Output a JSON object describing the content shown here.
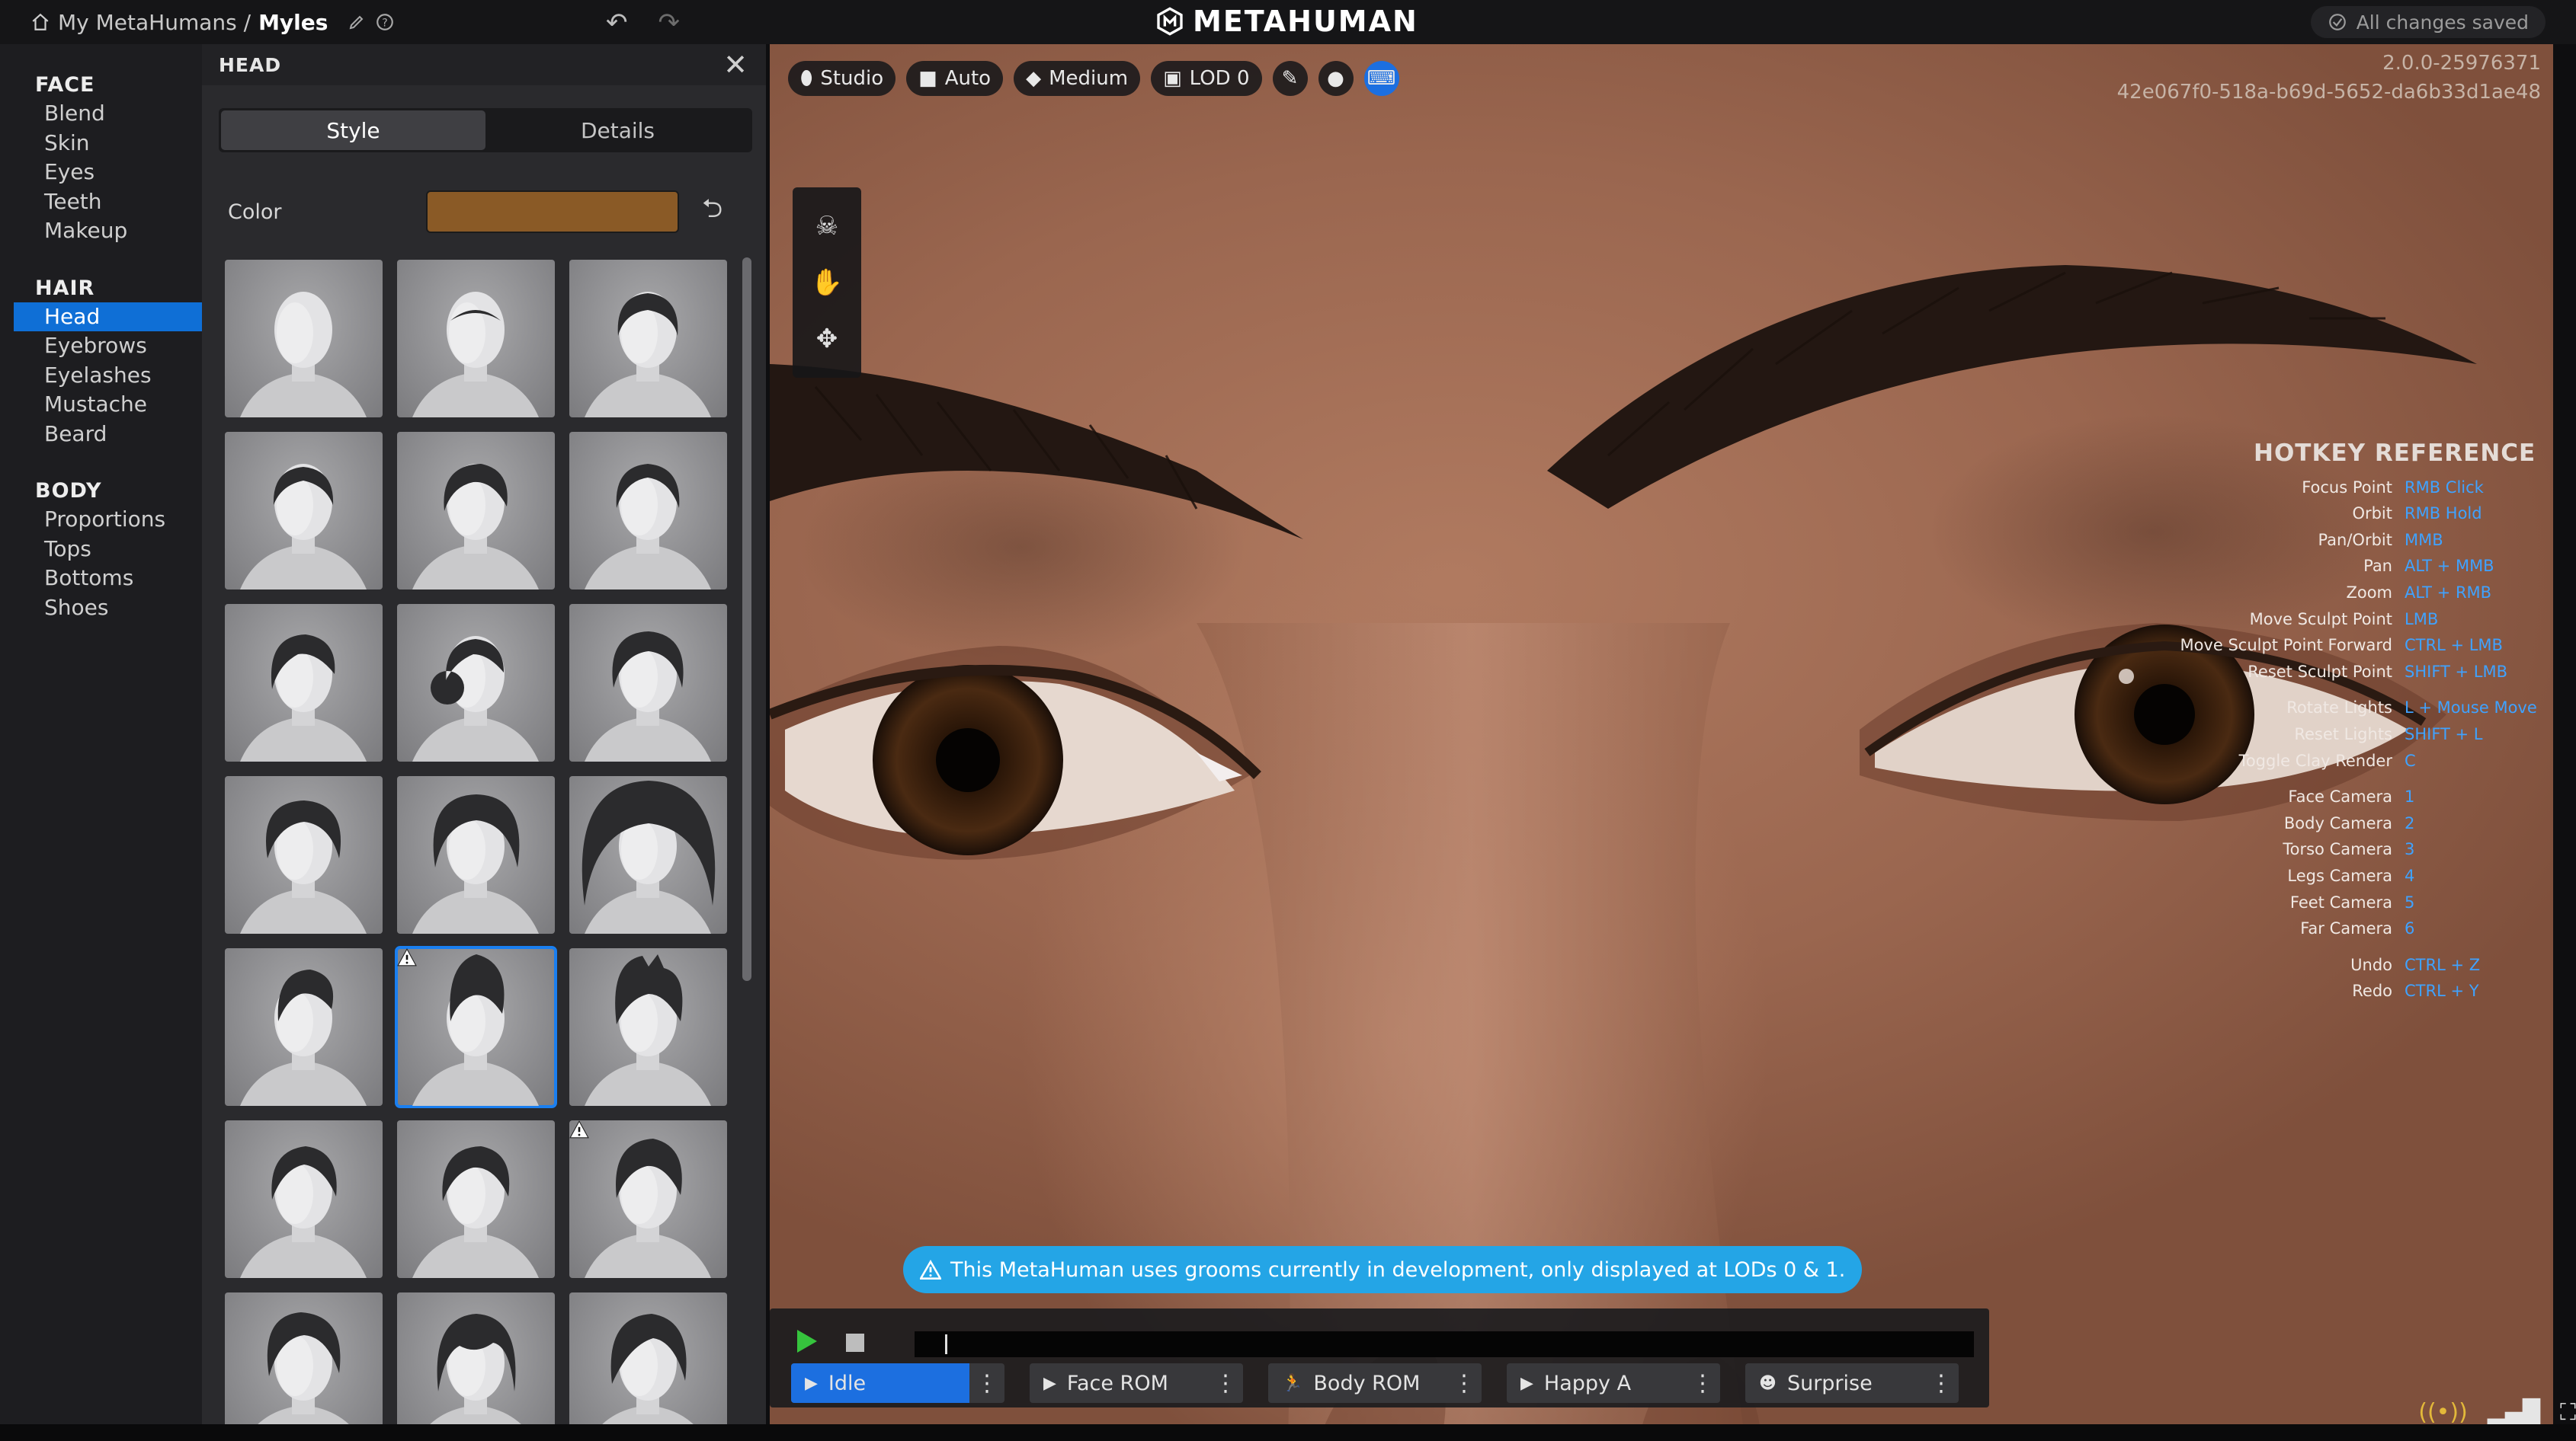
{
  "topbar": {
    "breadcrumb_root": "My MetaHumans /",
    "breadcrumb_current": "Myles",
    "logo": "METAHUMAN",
    "save_status": "All changes saved"
  },
  "nav": {
    "sections": [
      {
        "title": "FACE",
        "items": [
          "Blend",
          "Skin",
          "Eyes",
          "Teeth",
          "Makeup"
        ]
      },
      {
        "title": "HAIR",
        "items": [
          "Head",
          "Eyebrows",
          "Eyelashes",
          "Mustache",
          "Beard"
        ],
        "active": "Head"
      },
      {
        "title": "BODY",
        "items": [
          "Proportions",
          "Tops",
          "Bottoms",
          "Shoes"
        ]
      }
    ]
  },
  "panel": {
    "title": "HEAD",
    "tabs": [
      {
        "label": "Style",
        "active": true
      },
      {
        "label": "Details",
        "active": false
      }
    ],
    "color_label": "Color",
    "color_value": "#8a5a26",
    "styles": [
      {
        "hair": "bald",
        "warning": false,
        "selected": false
      },
      {
        "hair": "bald-receding",
        "warning": false,
        "selected": false
      },
      {
        "hair": "short-crop",
        "warning": false,
        "selected": false
      },
      {
        "hair": "buzz",
        "warning": false,
        "selected": false
      },
      {
        "hair": "side-part-short",
        "warning": false,
        "selected": false
      },
      {
        "hair": "cornrows",
        "warning": false,
        "selected": false
      },
      {
        "hair": "side-short",
        "warning": false,
        "selected": false
      },
      {
        "hair": "bun-low",
        "warning": false,
        "selected": false
      },
      {
        "hair": "short-wavy",
        "warning": false,
        "selected": false
      },
      {
        "hair": "short-curly",
        "warning": false,
        "selected": false
      },
      {
        "hair": "afro-short",
        "warning": false,
        "selected": false
      },
      {
        "hair": "afro-big",
        "warning": false,
        "selected": false
      },
      {
        "hair": "undercut",
        "warning": false,
        "selected": false
      },
      {
        "hair": "pompadour-high",
        "warning": true,
        "selected": true
      },
      {
        "hair": "pompadour-spiky",
        "warning": false,
        "selected": false
      },
      {
        "hair": "slick-back",
        "warning": false,
        "selected": false
      },
      {
        "hair": "slick-side",
        "warning": false,
        "selected": false
      },
      {
        "hair": "quiff",
        "warning": true,
        "selected": false
      },
      {
        "hair": "messy-top",
        "warning": false,
        "selected": false
      },
      {
        "hair": "bob-fringe",
        "warning": false,
        "selected": false
      },
      {
        "hair": "side-swept",
        "warning": false,
        "selected": false
      }
    ]
  },
  "viewport": {
    "toolbar": [
      {
        "icon": "pin-icon",
        "label": "Studio"
      },
      {
        "icon": "camera-icon",
        "label": "Auto"
      },
      {
        "icon": "gem-icon",
        "label": "Medium"
      },
      {
        "icon": "cube-icon",
        "label": "LOD 0"
      }
    ],
    "version": "2.0.0-25976371",
    "build_id": "42e067f0-518a-b69d-5652-da6b33d1ae48",
    "hotkeys": {
      "title": "HOTKEY REFERENCE",
      "groups": [
        [
          {
            "action": "Focus Point",
            "key": "RMB Click"
          },
          {
            "action": "Orbit",
            "key": "RMB Hold"
          },
          {
            "action": "Pan/Orbit",
            "key": "MMB"
          },
          {
            "action": "Pan",
            "key": "ALT + MMB"
          },
          {
            "action": "Zoom",
            "key": "ALT + RMB"
          },
          {
            "action": "Move Sculpt Point",
            "key": "LMB"
          },
          {
            "action": "Move Sculpt Point Forward",
            "key": "CTRL + LMB"
          },
          {
            "action": "Reset Sculpt Point",
            "key": "SHIFT + LMB"
          }
        ],
        [
          {
            "action": "Rotate Lights",
            "key": "L + Mouse Move"
          },
          {
            "action": "Reset Lights",
            "key": "SHIFT + L"
          },
          {
            "action": "Toggle Clay Render",
            "key": "C"
          }
        ],
        [
          {
            "action": "Face Camera",
            "key": "1"
          },
          {
            "action": "Body Camera",
            "key": "2"
          },
          {
            "action": "Torso Camera",
            "key": "3"
          },
          {
            "action": "Legs Camera",
            "key": "4"
          },
          {
            "action": "Feet Camera",
            "key": "5"
          },
          {
            "action": "Far Camera",
            "key": "6"
          }
        ],
        [
          {
            "action": "Undo",
            "key": "CTRL + Z"
          },
          {
            "action": "Redo",
            "key": "CTRL + Y"
          }
        ]
      ]
    },
    "notice": "This MetaHuman uses grooms currently in development, only displayed at LODs 0 & 1.",
    "animations": [
      {
        "label": "Idle",
        "icon": "play-circle-icon",
        "active": true
      },
      {
        "label": "Face ROM",
        "icon": "play-circle-icon",
        "active": false
      },
      {
        "label": "Body ROM",
        "icon": "running-icon",
        "active": false
      },
      {
        "label": "Happy A",
        "icon": "play-circle-icon",
        "active": false
      },
      {
        "label": "Surprise",
        "icon": "face-icon",
        "active": false
      }
    ]
  },
  "colors": {
    "accent": "#1c6fe0",
    "notice": "#24a5e6",
    "hotkey": "#3fa2ff"
  }
}
